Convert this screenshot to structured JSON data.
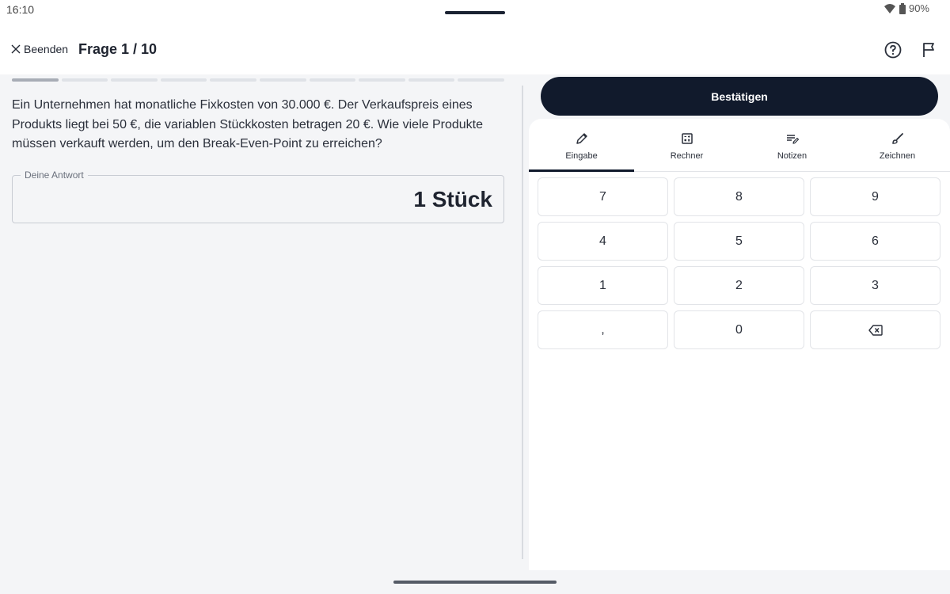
{
  "status_bar": {
    "time": "16:10",
    "battery": "90%"
  },
  "header": {
    "quit_label": "Beenden",
    "title": "Frage 1 / 10",
    "icons": [
      "help-icon",
      "flag-icon"
    ]
  },
  "progress": {
    "current": 1,
    "total": 10
  },
  "question": {
    "text": "Ein Unternehmen hat monatliche Fixkosten von 30.000 €. Der Verkaufspreis eines Produkts liegt bei 50 €, die variablen Stückkosten betragen 20 €. Wie viele Produkte müssen verkauft werden, um den Break-Even-Point zu erreichen?"
  },
  "answer": {
    "legend": "Deine Antwort",
    "value": "1 Stück"
  },
  "confirm_label": "Bestätigen",
  "tabs": [
    {
      "label": "Eingabe",
      "icon": "pencil-icon",
      "active": true
    },
    {
      "label": "Rechner",
      "icon": "calculator-icon",
      "active": false
    },
    {
      "label": "Notizen",
      "icon": "notes-icon",
      "active": false
    },
    {
      "label": "Zeichnen",
      "icon": "brush-icon",
      "active": false
    }
  ],
  "keypad": {
    "keys": [
      "7",
      "8",
      "9",
      "4",
      "5",
      "6",
      "1",
      "2",
      "3",
      ",",
      "0",
      "⌫"
    ]
  },
  "colors": {
    "primary": "#111a2c",
    "background": "#f4f5f7",
    "panel": "#ffffff"
  }
}
